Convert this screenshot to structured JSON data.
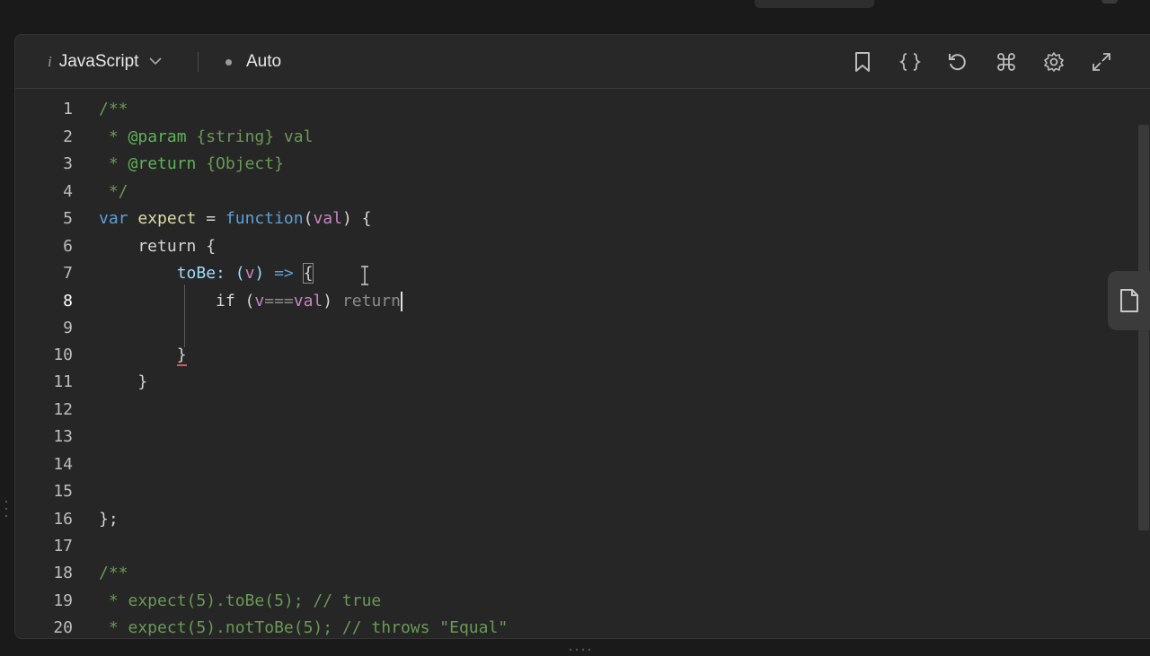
{
  "toolbar": {
    "info_glyph": "i",
    "language_label": "JavaScript",
    "mode_label": "Auto",
    "icons": [
      "bookmark-icon",
      "braces-icon",
      "reset-icon",
      "command-icon",
      "gear-icon",
      "expand-icon"
    ]
  },
  "editor": {
    "line_numbers": [
      "1",
      "2",
      "3",
      "4",
      "5",
      "6",
      "7",
      "8",
      "9",
      "10",
      "11",
      "12",
      "13",
      "14",
      "15",
      "16",
      "17",
      "18",
      "19",
      "20"
    ],
    "lines": [
      "/**",
      " * @param {string} val",
      " * @return {Object}",
      " */",
      "var expect = function(val) {",
      "    return {",
      "        toBe: (v) => {",
      "            if (v===val) return",
      "",
      "        }",
      "    }",
      "",
      "",
      "",
      "",
      "};",
      "",
      "/**",
      " * expect(5).toBe(5); // true",
      " * expect(5).notToBe(5); // throws \"Equal\""
    ]
  },
  "colors": {
    "background": "#262626",
    "comment": "#6a9955",
    "keyword": "#5c9fd6",
    "function": "#dcdcaa",
    "parameter": "#c586c0",
    "property": "#9cdcfe"
  }
}
